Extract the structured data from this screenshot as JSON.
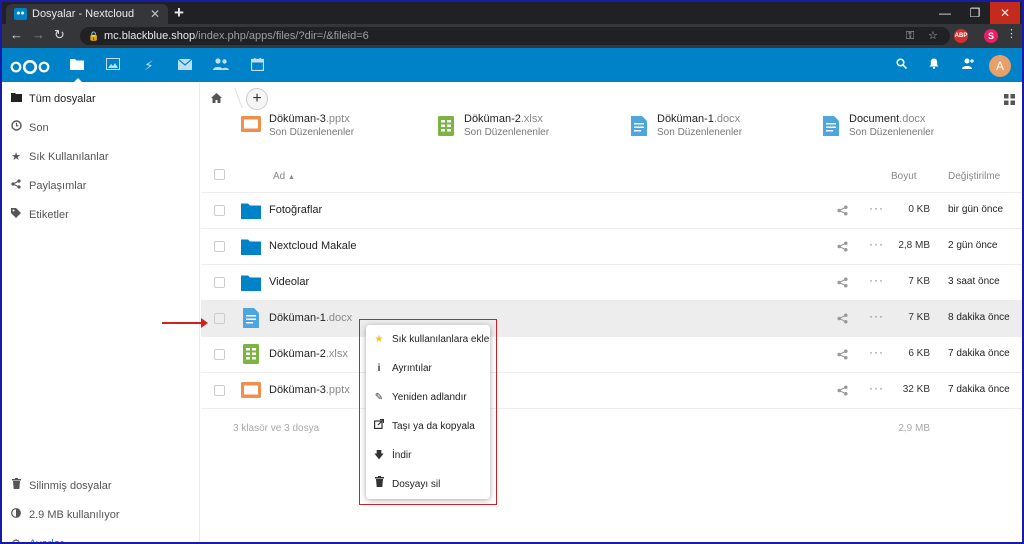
{
  "browser": {
    "tab_title": "Dosyalar - Nextcloud",
    "url_host": "mc.blackblue.shop",
    "url_path": "/index.php/apps/files/?dir=/&fileid=6",
    "ext_badge": "ABP",
    "profile_initial": "S"
  },
  "header": {
    "avatar_initial": "A"
  },
  "sidebar": {
    "items": [
      {
        "label": "Tüm dosyalar",
        "icon": "folder-icon"
      },
      {
        "label": "Son",
        "icon": "clock-icon"
      },
      {
        "label": "Sık Kullanılanlar",
        "icon": "star-icon"
      },
      {
        "label": "Paylaşımlar",
        "icon": "share-icon"
      },
      {
        "label": "Etiketler",
        "icon": "tag-icon"
      }
    ],
    "bottom": [
      {
        "label": "Silinmiş dosyalar",
        "icon": "trash-icon"
      },
      {
        "label": "2.9 MB kullanılıyor",
        "icon": "quota-icon"
      },
      {
        "label": "Ayarlar",
        "icon": "gear-icon"
      }
    ]
  },
  "recent": [
    {
      "name": "Döküman-3",
      "ext": ".pptx",
      "sub": "Son Düzenlenenler",
      "type": "pptx"
    },
    {
      "name": "Döküman-2",
      "ext": ".xlsx",
      "sub": "Son Düzenlenenler",
      "type": "xlsx"
    },
    {
      "name": "Döküman-1",
      "ext": ".docx",
      "sub": "Son Düzenlenenler",
      "type": "docx"
    },
    {
      "name": "Document",
      "ext": ".docx",
      "sub": "Son Düzenlenenler",
      "type": "docx"
    }
  ],
  "table": {
    "col_name": "Ad",
    "col_size": "Boyut",
    "col_modified": "Değiştirilme",
    "rows": [
      {
        "name": "Fotoğraflar",
        "ext": "",
        "size": "0 KB",
        "modified": "bir gün önce",
        "type": "folder"
      },
      {
        "name": "Nextcloud Makale",
        "ext": "",
        "size": "2,8 MB",
        "modified": "2 gün önce",
        "type": "folder"
      },
      {
        "name": "Videolar",
        "ext": "",
        "size": "7 KB",
        "modified": "3 saat önce",
        "type": "folder"
      },
      {
        "name": "Döküman-1",
        "ext": ".docx",
        "size": "7 KB",
        "modified": "8 dakika önce",
        "type": "docx"
      },
      {
        "name": "Döküman-2",
        "ext": ".xlsx",
        "size": "6 KB",
        "modified": "7 dakika önce",
        "type": "xlsx"
      },
      {
        "name": "Döküman-3",
        "ext": ".pptx",
        "size": "32 KB",
        "modified": "7 dakika önce",
        "type": "pptx"
      }
    ],
    "summary": "3 klasör ve 3 dosya",
    "summary_size": "2,9 MB"
  },
  "context_menu": [
    {
      "label": "Sık kullanılanlara ekle",
      "icon": "star-icon"
    },
    {
      "label": "Ayrıntılar",
      "icon": "info-icon"
    },
    {
      "label": "Yeniden adlandır",
      "icon": "pencil-icon"
    },
    {
      "label": "Taşı ya da kopyala",
      "icon": "move-icon"
    },
    {
      "label": "İndir",
      "icon": "download-icon"
    },
    {
      "label": "Dosyayı sil",
      "icon": "trash-icon"
    }
  ],
  "colors": {
    "brand": "#0082c9",
    "folder": "#0082c9",
    "docx": "#4da6e0",
    "xlsx": "#7cb342",
    "pptx": "#ef8f4b",
    "annotation": "#d21f1f"
  }
}
